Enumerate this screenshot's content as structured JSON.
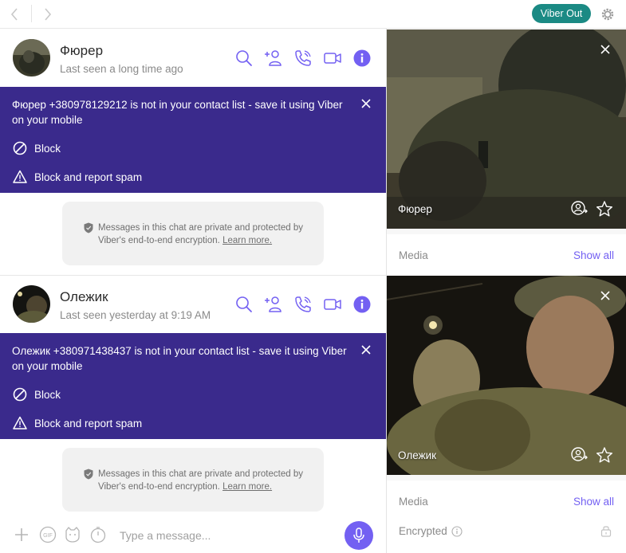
{
  "topbar": {
    "viber_out_label": "Viber Out",
    "icons": [
      "chevron-left-icon",
      "chevron-right-icon",
      "gear-icon"
    ]
  },
  "colors": {
    "accent": "#7360f2",
    "banner_bg": "#3a2a8c",
    "viber_out_bg": "#1b8a84",
    "notice_bg": "#f1f1f1"
  },
  "conversations": [
    {
      "name": "Фюрер",
      "status": "Last seen a long time ago",
      "banner_text": "Фюрер +380978129212 is not in your contact list - save it using Viber on your mobile",
      "block_label": "Block",
      "spam_label": "Block and report spam",
      "notice_text": "Messages in this chat are private and protected by Viber's end-to-end encryption.",
      "learn_more": "Learn more.",
      "info_name": "Фюрер",
      "media_label": "Media",
      "show_all_label": "Show all"
    },
    {
      "name": "Олежик",
      "status": "Last seen yesterday at 9:19 AM",
      "banner_text": "Олежик +380971438437 is not in your contact list - save it using Viber on your mobile",
      "block_label": "Block",
      "spam_label": "Block and report spam",
      "notice_text": "Messages in this chat are private and protected by Viber's end-to-end encryption.",
      "learn_more": "Learn more.",
      "info_name": "Олежик",
      "media_label": "Media",
      "show_all_label": "Show all",
      "encrypted_label": "Encrypted"
    }
  ],
  "composer": {
    "placeholder": "Type a message...",
    "gif_label": "GIF"
  }
}
